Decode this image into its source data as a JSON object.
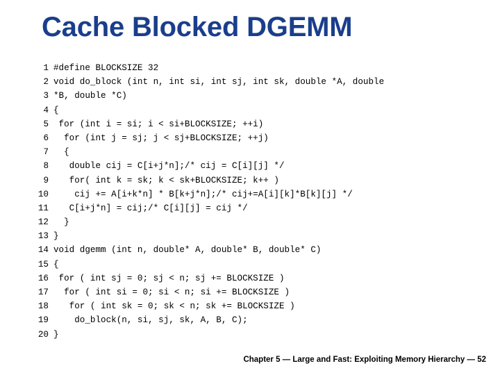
{
  "slide": {
    "title": "Cache Blocked DGEMM",
    "title_color": "#1a3e8c",
    "background_color": "#ffffff",
    "text_color": "#000000"
  },
  "code": {
    "language": "c",
    "lines": [
      {
        "number": "1",
        "text": "#define BLOCKSIZE 32"
      },
      {
        "number": "2",
        "text": "void do_block (int n, int si, int sj, int sk, double *A, double"
      },
      {
        "number": "3",
        "text": "*B, double *C)"
      },
      {
        "number": "4",
        "text": "{"
      },
      {
        "number": "5",
        "text": " for (int i = si; i < si+BLOCKSIZE; ++i)"
      },
      {
        "number": "6",
        "text": "  for (int j = sj; j < sj+BLOCKSIZE; ++j)"
      },
      {
        "number": "7",
        "text": "  {"
      },
      {
        "number": "8",
        "text": "   double cij = C[i+j*n];/* cij = C[i][j] */"
      },
      {
        "number": "9",
        "text": "   for( int k = sk; k < sk+BLOCKSIZE; k++ )"
      },
      {
        "number": "10",
        "text": "    cij += A[i+k*n] * B[k+j*n];/* cij+=A[i][k]*B[k][j] */"
      },
      {
        "number": "11",
        "text": "   C[i+j*n] = cij;/* C[i][j] = cij */"
      },
      {
        "number": "12",
        "text": "  }"
      },
      {
        "number": "13",
        "text": "}"
      },
      {
        "number": "14",
        "text": "void dgemm (int n, double* A, double* B, double* C)"
      },
      {
        "number": "15",
        "text": "{"
      },
      {
        "number": "16",
        "text": " for ( int sj = 0; sj < n; sj += BLOCKSIZE )"
      },
      {
        "number": "17",
        "text": "  for ( int si = 0; si < n; si += BLOCKSIZE )"
      },
      {
        "number": "18",
        "text": "   for ( int sk = 0; sk < n; sk += BLOCKSIZE )"
      },
      {
        "number": "19",
        "text": "    do_block(n, si, sj, sk, A, B, C);"
      },
      {
        "number": "20",
        "text": "}"
      }
    ]
  },
  "footer": {
    "text": "Chapter 5 — Large and Fast: Exploiting Memory Hierarchy — 52"
  }
}
